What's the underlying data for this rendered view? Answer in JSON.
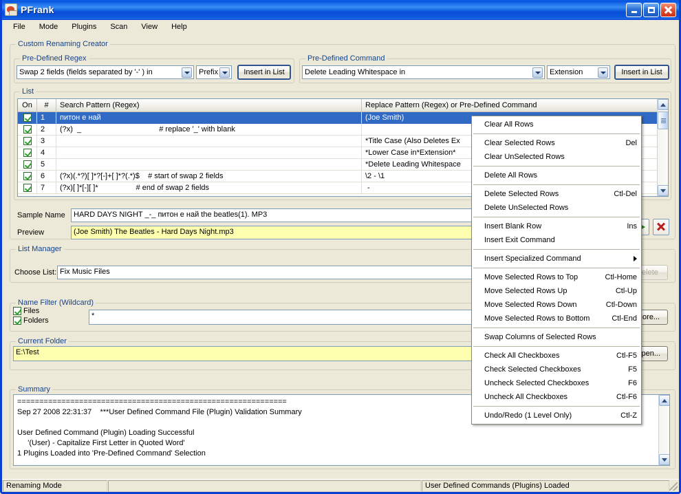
{
  "window": {
    "title": "PFrank",
    "icon": "app-icon",
    "buttons": {
      "minimize": "Minimize",
      "maximize": "Maximize",
      "close": "Close"
    }
  },
  "menubar": [
    "File",
    "Mode",
    "Plugins",
    "Scan",
    "View",
    "Help"
  ],
  "custom_renaming_creator": {
    "label": "Custom Renaming Creator",
    "predefined_regex": {
      "label": "Pre-Defined Regex",
      "combo_value": "Swap 2 fields (fields separated by '-' ) in",
      "scope_value": "Prefix",
      "insert_button": "Insert in List"
    },
    "predefined_command": {
      "label": "Pre-Defined Command",
      "combo_value": "Delete Leading Whitespace in",
      "scope_value": "Extension",
      "insert_button": "Insert in List"
    },
    "list": {
      "label": "List",
      "columns": [
        "On",
        "#",
        "Search Pattern (Regex)",
        "Replace Pattern (Regex)  or  Pre-Defined Command"
      ],
      "rows": [
        {
          "on": true,
          "num": "1",
          "search": "питон е най",
          "replace": "(Joe Smith)",
          "selected": true
        },
        {
          "on": true,
          "num": "2",
          "search": "(?x)  _                                     # replace '_' with blank",
          "replace": "",
          "selected": false
        },
        {
          "on": true,
          "num": "3",
          "search": "",
          "replace": "*Title Case (Also Deletes Ex",
          "selected": false
        },
        {
          "on": true,
          "num": "4",
          "search": "",
          "replace": "*Lower Case in*Extension*",
          "selected": false
        },
        {
          "on": true,
          "num": "5",
          "search": "",
          "replace": "*Delete Leading Whitespace",
          "selected": false
        },
        {
          "on": true,
          "num": "6",
          "search": "(?x)(.*?)[ ]*?[-]+[ ]*?(.*)$    # start of swap 2 fields",
          "replace": "\\2 - \\1",
          "selected": false
        },
        {
          "on": true,
          "num": "7",
          "search": "(?x)[ ]*[-][ ]*                  # end of swap 2 fields",
          "replace": " -",
          "selected": false
        }
      ]
    },
    "sample_name": {
      "label": "Sample Name",
      "value": "HARD DAYS NIGHT _-_ питон е най            the beatles(1).  MP3"
    },
    "preview": {
      "label": "Preview",
      "value": "(Joe Smith) The Beatles - Hard Days Night.mp3"
    }
  },
  "list_manager": {
    "label": "List Manager",
    "choose_list_label": "Choose List:",
    "choose_list_value": "Fix Music Files",
    "delete_button": "Delete"
  },
  "name_filter": {
    "label": "Name Filter (Wildcard)",
    "files_label": "Files",
    "folders_label": "Folders",
    "pattern_value": "*",
    "more_button": "More..."
  },
  "current_folder": {
    "label": "Current Folder",
    "value": "E:\\Test",
    "browse_button": "Open..."
  },
  "summary": {
    "label": "Summary",
    "text": "=============================================================\nSep 27 2008 22:31:37    ***User Defined Command File (Plugin) Validation Summary\n\nUser Defined Command (Plugin) Loading Successful\n     '(User) - Capitalize First Letter in Quoted Word'\n1 Plugins Loaded into 'Pre-Defined Command' Selection"
  },
  "context_menu": {
    "groups": [
      [
        {
          "label": "Clear All Rows",
          "accel": ""
        }
      ],
      [
        {
          "label": "Clear Selected Rows",
          "accel": "Del"
        },
        {
          "label": "Clear UnSelected Rows",
          "accel": ""
        }
      ],
      [
        {
          "label": "Delete All Rows",
          "accel": ""
        }
      ],
      [
        {
          "label": "Delete Selected Rows",
          "accel": "Ctl-Del"
        },
        {
          "label": "Delete UnSelected Rows",
          "accel": ""
        }
      ],
      [
        {
          "label": "Insert Blank Row",
          "accel": "Ins"
        },
        {
          "label": "Insert Exit Command",
          "accel": ""
        }
      ],
      [
        {
          "label": "Insert Specialized Command",
          "accel": "",
          "submenu": true
        }
      ],
      [
        {
          "label": "Move Selected Rows to Top",
          "accel": "Ctl-Home"
        },
        {
          "label": "Move Selected Rows Up",
          "accel": "Ctl-Up"
        },
        {
          "label": "Move Selected Rows Down",
          "accel": "Ctl-Down"
        },
        {
          "label": "Move Selected Rows to Bottom",
          "accel": "Ctl-End"
        }
      ],
      [
        {
          "label": "Swap Columns of Selected Rows",
          "accel": ""
        }
      ],
      [
        {
          "label": "Check All Checkboxes",
          "accel": "Ctl-F5"
        },
        {
          "label": "Check Selected Checkboxes",
          "accel": "F5"
        },
        {
          "label": "Uncheck Selected Checkboxes",
          "accel": "F6"
        },
        {
          "label": "Uncheck All Checkboxes",
          "accel": "Ctl-F6"
        }
      ],
      [
        {
          "label": "Undo/Redo (1 Level Only)",
          "accel": "Ctl-Z"
        }
      ]
    ]
  },
  "statusbar": {
    "mode": "Renaming Mode",
    "middle": "",
    "plugins": "User Defined Commands (Plugins) Loaded"
  },
  "colors": {
    "titlebar_blue": "#0a53dd",
    "group_label_blue": "#15428b",
    "selection_blue": "#316ac5",
    "preview_yellow": "#ffffb0",
    "face": "#ece9d8"
  }
}
